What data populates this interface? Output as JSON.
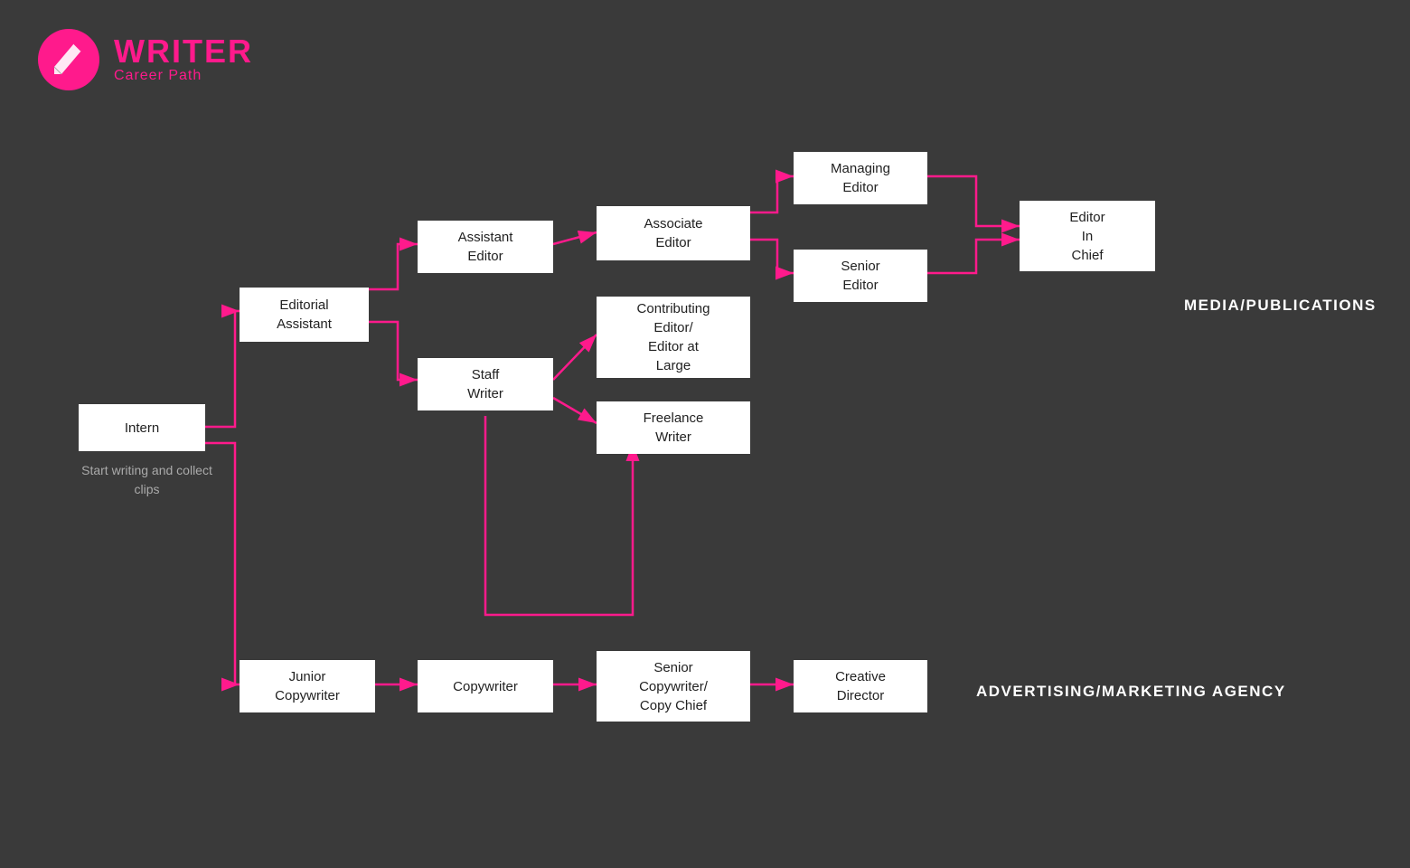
{
  "header": {
    "logo_title": "WRITER",
    "logo_subtitle": "Career Path"
  },
  "nodes": {
    "intern": {
      "label": "Intern"
    },
    "start_text": {
      "label": "Start writing\nand collect\nclips"
    },
    "editorial_assistant": {
      "label": "Editorial\nAssistant"
    },
    "assistant_editor": {
      "label": "Assistant\nEditor"
    },
    "staff_writer": {
      "label": "Staff\nWriter"
    },
    "associate_editor": {
      "label": "Associate\nEditor"
    },
    "contributing_editor": {
      "label": "Contributing\nEditor/\nEditor at\nLarge"
    },
    "freelance_writer": {
      "label": "Freelance\nWriter"
    },
    "managing_editor": {
      "label": "Managing\nEditor"
    },
    "senior_editor": {
      "label": "Senior\nEditor"
    },
    "editor_in_chief": {
      "label": "Editor\nIn\nChief"
    },
    "junior_copywriter": {
      "label": "Junior\nCopywriter"
    },
    "copywriter": {
      "label": "Copywriter"
    },
    "senior_copywriter": {
      "label": "Senior\nCopywriter/\nCopy Chief"
    },
    "creative_director": {
      "label": "Creative\nDirector"
    }
  },
  "labels": {
    "media": "MEDIA/PUBLICATIONS",
    "advertising": "ADVERTISING/MARKETING AGENCY"
  },
  "colors": {
    "pink": "#ff1a8c",
    "bg": "#3a3a3a",
    "node_bg": "#ffffff",
    "node_text": "#222222",
    "white": "#ffffff"
  }
}
